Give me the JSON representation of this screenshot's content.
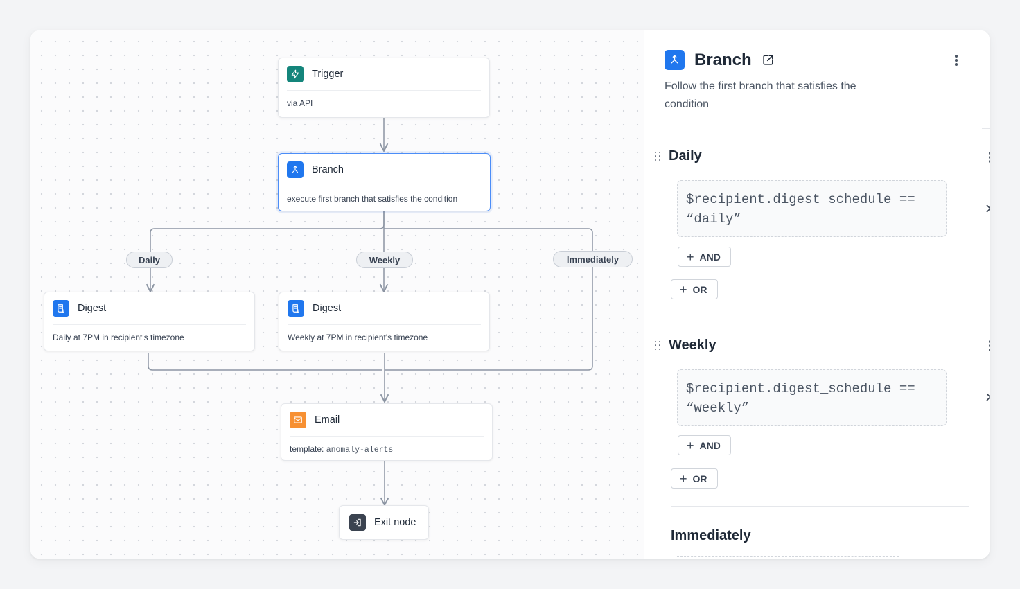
{
  "canvas": {
    "nodes": {
      "trigger": {
        "title": "Trigger",
        "subtitle": "via API"
      },
      "branch": {
        "title": "Branch",
        "subtitle": "execute first branch that satisfies the condition"
      },
      "digest_daily": {
        "title": "Digest",
        "subtitle": "Daily at 7PM in recipient's timezone"
      },
      "digest_weekly": {
        "title": "Digest",
        "subtitle": "Weekly at 7PM in recipient's timezone"
      },
      "email": {
        "title": "Email",
        "subtitle_label": "template:",
        "subtitle_code": "anomaly-alerts"
      },
      "exit": {
        "title": "Exit node"
      }
    },
    "branch_labels": {
      "daily": "Daily",
      "weekly": "Weekly",
      "immediately": "Immediately"
    }
  },
  "panel": {
    "title": "Branch",
    "title_icon": "branch-icon",
    "external_link_icon": "external-link-icon",
    "description": "Follow the first branch that satisfies the condition",
    "sections": [
      {
        "name": "Daily",
        "condition_line1": "$recipient.digest_schedule ==",
        "condition_line2": "“daily”",
        "and_label": "AND",
        "or_label": "OR"
      },
      {
        "name": "Weekly",
        "condition_line1": "$recipient.digest_schedule ==",
        "condition_line2": "“weekly”",
        "and_label": "AND",
        "or_label": "OR"
      },
      {
        "name": "Immediately"
      }
    ]
  },
  "colors": {
    "accent_blue": "#2077ee",
    "teal": "#14857b",
    "orange": "#f79032",
    "edge": "#8c95a3",
    "selected_border": "#4b8df8"
  }
}
